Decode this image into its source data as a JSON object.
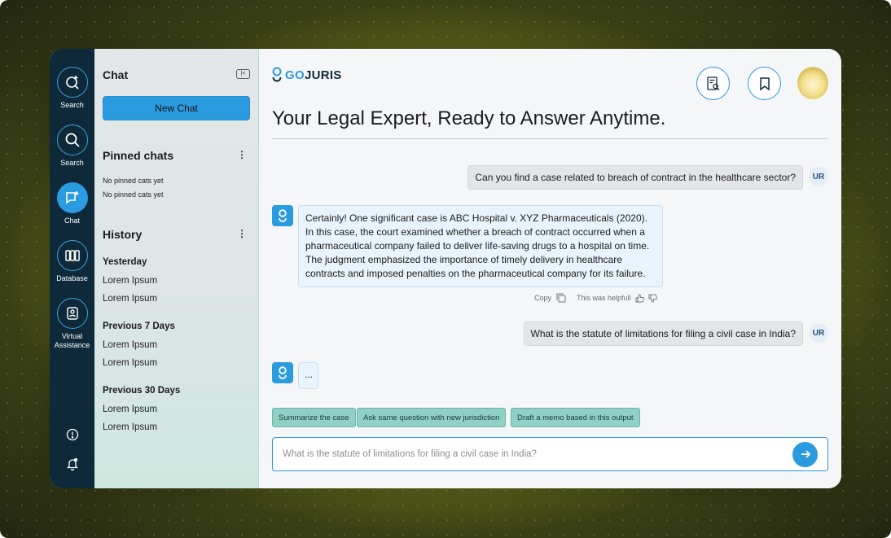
{
  "rail": {
    "items": [
      {
        "label": "Search",
        "icon": "new-search-icon",
        "active": false
      },
      {
        "label": "Search",
        "icon": "search-icon",
        "active": false
      },
      {
        "label": "Chat",
        "icon": "chat-icon",
        "active": true
      },
      {
        "label": "Database",
        "icon": "database-icon",
        "active": false
      },
      {
        "label": "Virtual Assistance",
        "icon": "assistant-icon",
        "active": false
      }
    ],
    "bottom_icons": [
      "info-icon",
      "bell-icon"
    ]
  },
  "sidebar": {
    "title": "Chat",
    "collapse_glyph": "|<",
    "new_chat_label": "New Chat",
    "pinned": {
      "title": "Pinned chats",
      "empty": [
        "No pinned cats yet",
        "No pinned cats yet"
      ]
    },
    "history": {
      "title": "History",
      "groups": [
        {
          "label": "Yesterday",
          "items": [
            "Lorem Ipsum",
            "Lorem Ipsum"
          ]
        },
        {
          "label": "Previous 7 Days",
          "items": [
            "Lorem Ipsum",
            "Lorem Ipsum"
          ]
        },
        {
          "label": "Previous 30 Days",
          "items": [
            "Lorem Ipsum",
            "Lorem Ipsum"
          ]
        }
      ]
    }
  },
  "header": {
    "logo_go": "GO",
    "logo_juris": "JURIS",
    "heading": "Your Legal Expert, Ready to Answer Anytime."
  },
  "messages": {
    "q1": "Can you find a case related to breach of contract in the healthcare sector?",
    "user_initials": "UR",
    "a1": "Certainly! One significant case is ABC Hospital v. XYZ Pharmaceuticals (2020). In this case, the court examined whether a breach of contract occurred when a pharmaceutical company failed to deliver life-saving drugs to a hospital on time. The judgment emphasized the importance of timely delivery in healthcare contracts and imposed penalties on the pharmaceutical company for its failure.",
    "copy_label": "Copy",
    "helpful_label": "This was helpfull",
    "q2": "What is the statute of limitations for filing a civil case in India?",
    "typing": "..."
  },
  "suggestions": [
    "Summarize the case",
    "Ask same question with new jurisdiction",
    "Draft a memo  based in this output"
  ],
  "composer": {
    "placeholder": "What is the statute of limitations for filing a civil case in India?"
  },
  "colors": {
    "accent": "#2b9be0",
    "rail": "#0e2a3a",
    "chip": "#8fd1c5"
  }
}
